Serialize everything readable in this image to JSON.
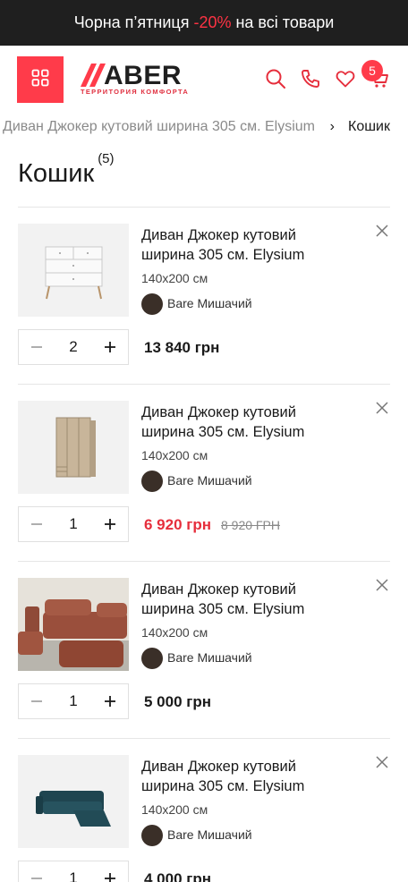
{
  "promo": {
    "before": "Чорна п’ятниця",
    "discount": "-20%",
    "after": "на всі товари"
  },
  "header": {
    "logo_word": "ABER",
    "logo_tagline": "ТЕРРИТОРИЯ КОМФОРТА",
    "cart_count": "5",
    "icons": [
      "menu-grid-icon",
      "search-icon",
      "phone-icon",
      "heart-icon",
      "cart-icon"
    ],
    "accent_color": "#ff3b4a"
  },
  "breadcrumb": {
    "previous": "Диван Джокер кутовий ширина 305 см. Elysium",
    "separator": "›",
    "current": "Кошик"
  },
  "page": {
    "title": "Кошик",
    "count": "(5)"
  },
  "items": [
    {
      "name": "Диван Джокер кутовий ширина 305 см. Elysium",
      "size": "140x200 см",
      "color": "Bare Мишачий",
      "qty": "2",
      "price": "13 840 грн",
      "old_price": "",
      "image": "white-dresser"
    },
    {
      "name": "Диван Джокер кутовий ширина 305 см. Elysium",
      "size": "140x200 см",
      "color": "Bare Мишачий",
      "qty": "1",
      "price": "6 920 грн",
      "old_price": "8 920 ГРН",
      "image": "wood-wardrobe"
    },
    {
      "name": "Диван Джокер кутовий ширина 305 см. Elysium",
      "size": "140x200 см",
      "color": "Bare Мишачий",
      "qty": "1",
      "price": "5 000 грн",
      "old_price": "",
      "image": "brown-modular-sofa"
    },
    {
      "name": "Диван Джокер кутовий ширина 305 см. Elysium",
      "size": "140x200 см",
      "color": "Bare Мишачий",
      "qty": "1",
      "price": "4 000 грн",
      "old_price": "",
      "image": "teal-corner-sofa"
    }
  ]
}
